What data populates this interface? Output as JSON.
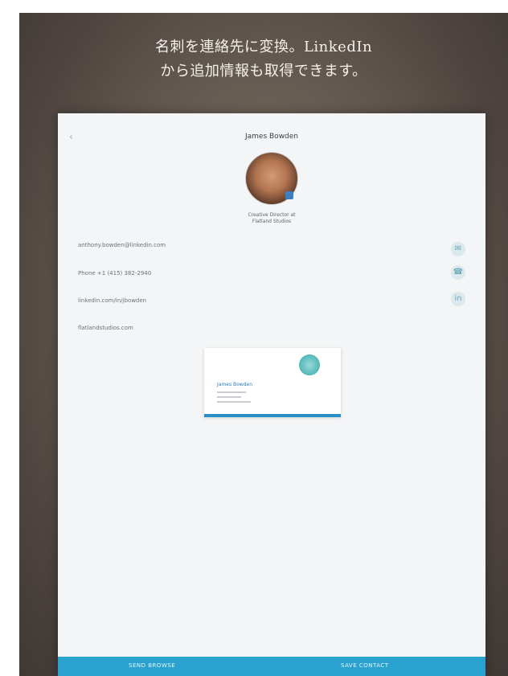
{
  "caption": {
    "line1": "名刺を連絡先に変換。LinkedIn",
    "line2": "から追加情報も取得できます。"
  },
  "contact": {
    "back_icon": "back-arrow-icon",
    "name": "James Bowden",
    "subtitle_line1": "Creative Director at",
    "subtitle_line2": "Flatland Studios"
  },
  "fields": [
    {
      "text": "anthony.bowden@linkedin.com"
    },
    {
      "text": "Phone +1 (415) 382-2940"
    },
    {
      "text": "linkedin.com/in/jbowden"
    },
    {
      "text": "flatlandstudios.com"
    }
  ],
  "actions": [
    {
      "icon": "message-icon"
    },
    {
      "icon": "phone-icon"
    },
    {
      "icon": "linkedin-icon"
    }
  ],
  "card": {
    "name": "James Bowden",
    "logo_icon": "card-logo-icon"
  },
  "bottom_bar": {
    "left_label": "SEND BROWSE",
    "right_label": "SAVE CONTACT"
  },
  "colors": {
    "accent": "#2aa2cf",
    "card_bar": "#2a8fc5",
    "background": "#4f4540"
  }
}
